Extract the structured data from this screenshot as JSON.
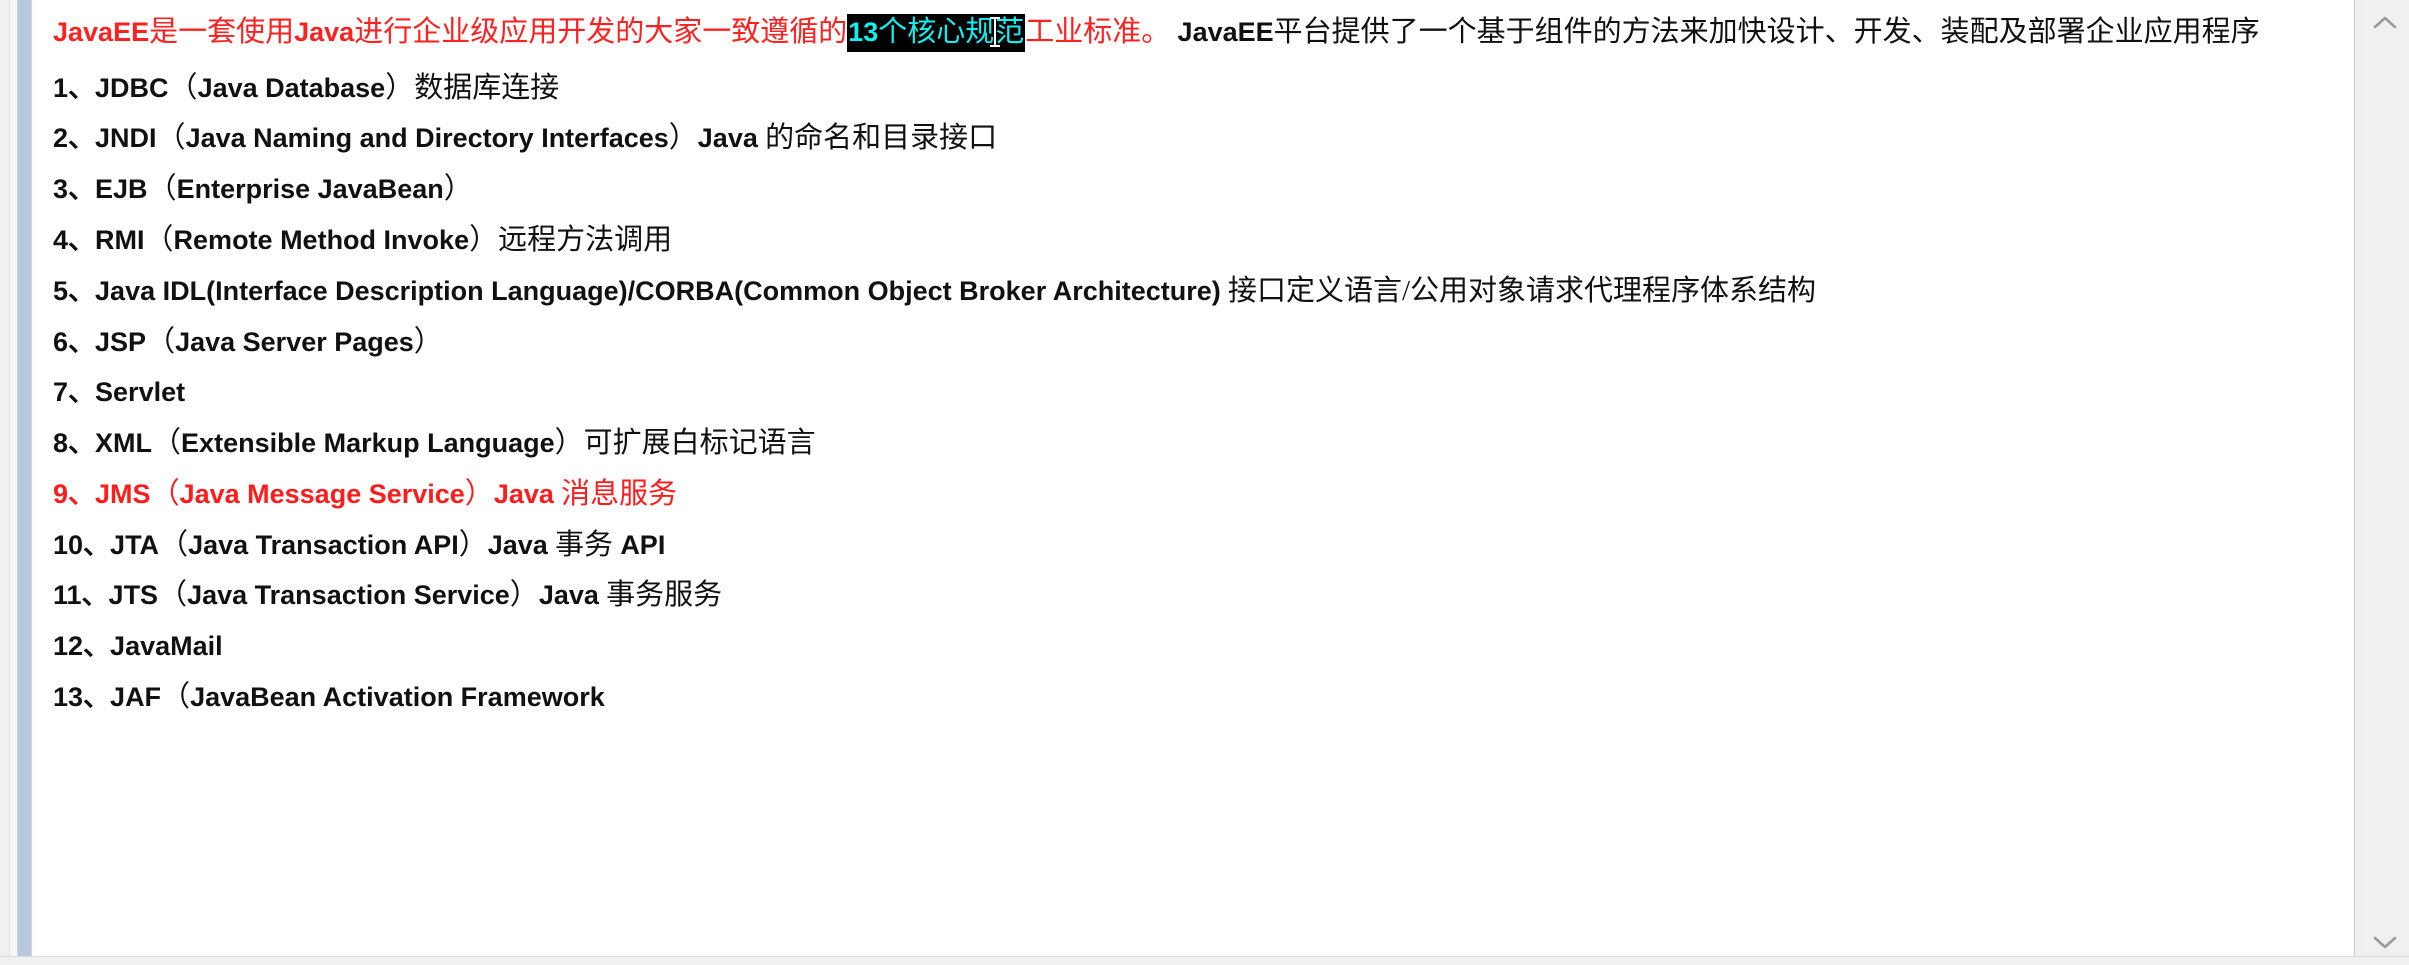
{
  "window": {
    "background_color": "#ffffff",
    "accent_border_color": "#b8c8dc"
  },
  "colors": {
    "red_text": "#ff2020",
    "black_text": "#111111",
    "selection_background": "#000000",
    "selection_text": "#0ff0f0",
    "scrollbar_track": "#f0f0f0",
    "scrollbar_arrow": "#9a9a9a"
  },
  "document": {
    "intro": {
      "red_before": "JavaEE是一套使用Java进行企业级应用开发的大家一致遵循的",
      "red_before_parts": [
        {
          "text": "JavaEE",
          "script": "latin"
        },
        {
          "text": "是一套使用",
          "script": "cjk"
        },
        {
          "text": "Java",
          "script": "latin"
        },
        {
          "text": "进行企业级应用开发的大家一致遵循的",
          "script": "cjk"
        }
      ],
      "selected_text": "13个核心规范",
      "selected_parts": [
        {
          "text": "13",
          "script": "latin"
        },
        {
          "text": "个核心规",
          "script": "cjk"
        },
        {
          "text": "范",
          "script": "cjk"
        }
      ],
      "red_after": "工业标准。",
      "black_after": "JavaEE平台提供了一个基于组件的方法来加快设计、开发、装配及部署企业应用程序",
      "black_after_parts": [
        {
          "text": "JavaEE",
          "script": "latin"
        },
        {
          "text": "平台提供了一个基于组件的方法来加快设计、开发、装配及部署企业应用程序",
          "script": "cjk"
        }
      ]
    },
    "specs_heading_count": 13,
    "specs": [
      {
        "number": "1、",
        "color": "black",
        "segments": [
          {
            "text": "JDBC",
            "script": "latin"
          },
          {
            "text": "（",
            "script": "cjk"
          },
          {
            "text": "Java Database",
            "script": "latin"
          },
          {
            "text": "）",
            "script": "cjk"
          },
          {
            "text": "数据库连接",
            "script": "cjk"
          }
        ]
      },
      {
        "number": "2、",
        "color": "black",
        "segments": [
          {
            "text": "JNDI",
            "script": "latin"
          },
          {
            "text": "（",
            "script": "cjk"
          },
          {
            "text": "Java Naming and Directory Interfaces",
            "script": "latin"
          },
          {
            "text": "）",
            "script": "cjk"
          },
          {
            "text": "Java",
            "script": "latin"
          },
          {
            "text": " 的命名和目录接口",
            "script": "cjk"
          }
        ]
      },
      {
        "number": "3、",
        "color": "black",
        "segments": [
          {
            "text": "EJB",
            "script": "latin"
          },
          {
            "text": "（",
            "script": "cjk"
          },
          {
            "text": "Enterprise JavaBean",
            "script": "latin"
          },
          {
            "text": "）",
            "script": "cjk"
          }
        ]
      },
      {
        "number": "4、",
        "color": "black",
        "segments": [
          {
            "text": "RMI",
            "script": "latin"
          },
          {
            "text": "（",
            "script": "cjk"
          },
          {
            "text": "Remote Method Invoke",
            "script": "latin"
          },
          {
            "text": "）",
            "script": "cjk"
          },
          {
            "text": "远程方法调用",
            "script": "cjk"
          }
        ]
      },
      {
        "number": "5、",
        "color": "black",
        "segments": [
          {
            "text": "Java IDL(Interface Description Language)/CORBA(Common Object Broker Architecture)",
            "script": "latin"
          },
          {
            "text": " 接口定义语言/公用对象请求代理程序体系结构",
            "script": "cjk"
          }
        ]
      },
      {
        "number": "6、",
        "color": "black",
        "segments": [
          {
            "text": "JSP",
            "script": "latin"
          },
          {
            "text": "（",
            "script": "cjk"
          },
          {
            "text": "Java Server Pages",
            "script": "latin"
          },
          {
            "text": "）",
            "script": "cjk"
          }
        ]
      },
      {
        "number": "7、",
        "color": "black",
        "segments": [
          {
            "text": "Servlet",
            "script": "latin"
          }
        ]
      },
      {
        "number": "8、",
        "color": "black",
        "segments": [
          {
            "text": "XML",
            "script": "latin"
          },
          {
            "text": "（",
            "script": "cjk"
          },
          {
            "text": "Extensible Markup Language",
            "script": "latin"
          },
          {
            "text": "）",
            "script": "cjk"
          },
          {
            "text": "可扩展白标记语言",
            "script": "cjk"
          }
        ]
      },
      {
        "number": "9、",
        "color": "red",
        "segments": [
          {
            "text": "JMS",
            "script": "latin"
          },
          {
            "text": "（",
            "script": "cjk"
          },
          {
            "text": "Java Message Service",
            "script": "latin"
          },
          {
            "text": "）",
            "script": "cjk"
          },
          {
            "text": "Java",
            "script": "latin"
          },
          {
            "text": " 消息服务",
            "script": "cjk"
          }
        ]
      },
      {
        "number": "10、",
        "color": "black",
        "segments": [
          {
            "text": "JTA",
            "script": "latin"
          },
          {
            "text": "（",
            "script": "cjk"
          },
          {
            "text": "Java Transaction API",
            "script": "latin"
          },
          {
            "text": "）",
            "script": "cjk"
          },
          {
            "text": "Java",
            "script": "latin"
          },
          {
            "text": " 事务 ",
            "script": "cjk"
          },
          {
            "text": "API",
            "script": "latin"
          }
        ]
      },
      {
        "number": "11、",
        "color": "black",
        "segments": [
          {
            "text": "JTS",
            "script": "latin"
          },
          {
            "text": "（",
            "script": "cjk"
          },
          {
            "text": "Java Transaction Service",
            "script": "latin"
          },
          {
            "text": "）",
            "script": "cjk"
          },
          {
            "text": "Java",
            "script": "latin"
          },
          {
            "text": " 事务服务",
            "script": "cjk"
          }
        ]
      },
      {
        "number": "12、",
        "color": "black",
        "segments": [
          {
            "text": "JavaMail",
            "script": "latin"
          }
        ]
      },
      {
        "number": "13、",
        "color": "black",
        "segments": [
          {
            "text": "JAF",
            "script": "latin"
          },
          {
            "text": "（",
            "script": "cjk"
          },
          {
            "text": "JavaBean Activation Framework",
            "script": "latin"
          }
        ]
      }
    ]
  },
  "scrollbar": {
    "up_arrow_icon": "chevron-up-icon",
    "down_arrow_icon": "chevron-down-icon",
    "thumb_visible": false
  }
}
